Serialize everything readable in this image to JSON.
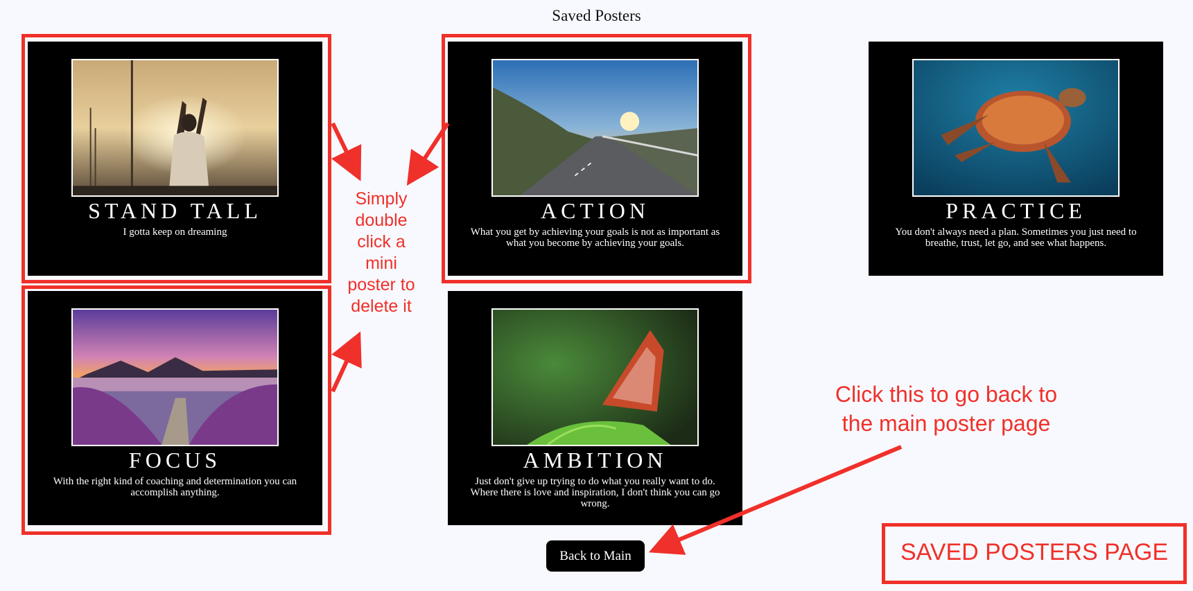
{
  "page_title": "Saved Posters",
  "posters": [
    {
      "title": "STAND TALL",
      "quote": "I gotta keep on dreaming"
    },
    {
      "title": "ACTION",
      "quote": "What you get by achieving your goals is not as important as what you become by achieving your goals."
    },
    {
      "title": "PRACTICE",
      "quote": "You don't always need a plan. Sometimes you just need to breathe, trust, let go, and see what happens."
    },
    {
      "title": "FOCUS",
      "quote": "With the right kind of coaching and determination you can accomplish anything."
    },
    {
      "title": "AMBITION",
      "quote": "Just don't give up trying to do what you really want to do. Where there is love and inspiration, I don't think you can go wrong."
    }
  ],
  "back_button_label": "Back to Main",
  "annotations": {
    "delete_hint": "Simply double click a mini poster to delete it",
    "back_hint": "Click this to go back to the main poster page",
    "page_label": "SAVED POSTERS PAGE"
  },
  "colors": {
    "annotation": "#f0302a",
    "poster_bg": "#000000",
    "page_bg": "#f8f9fe"
  }
}
